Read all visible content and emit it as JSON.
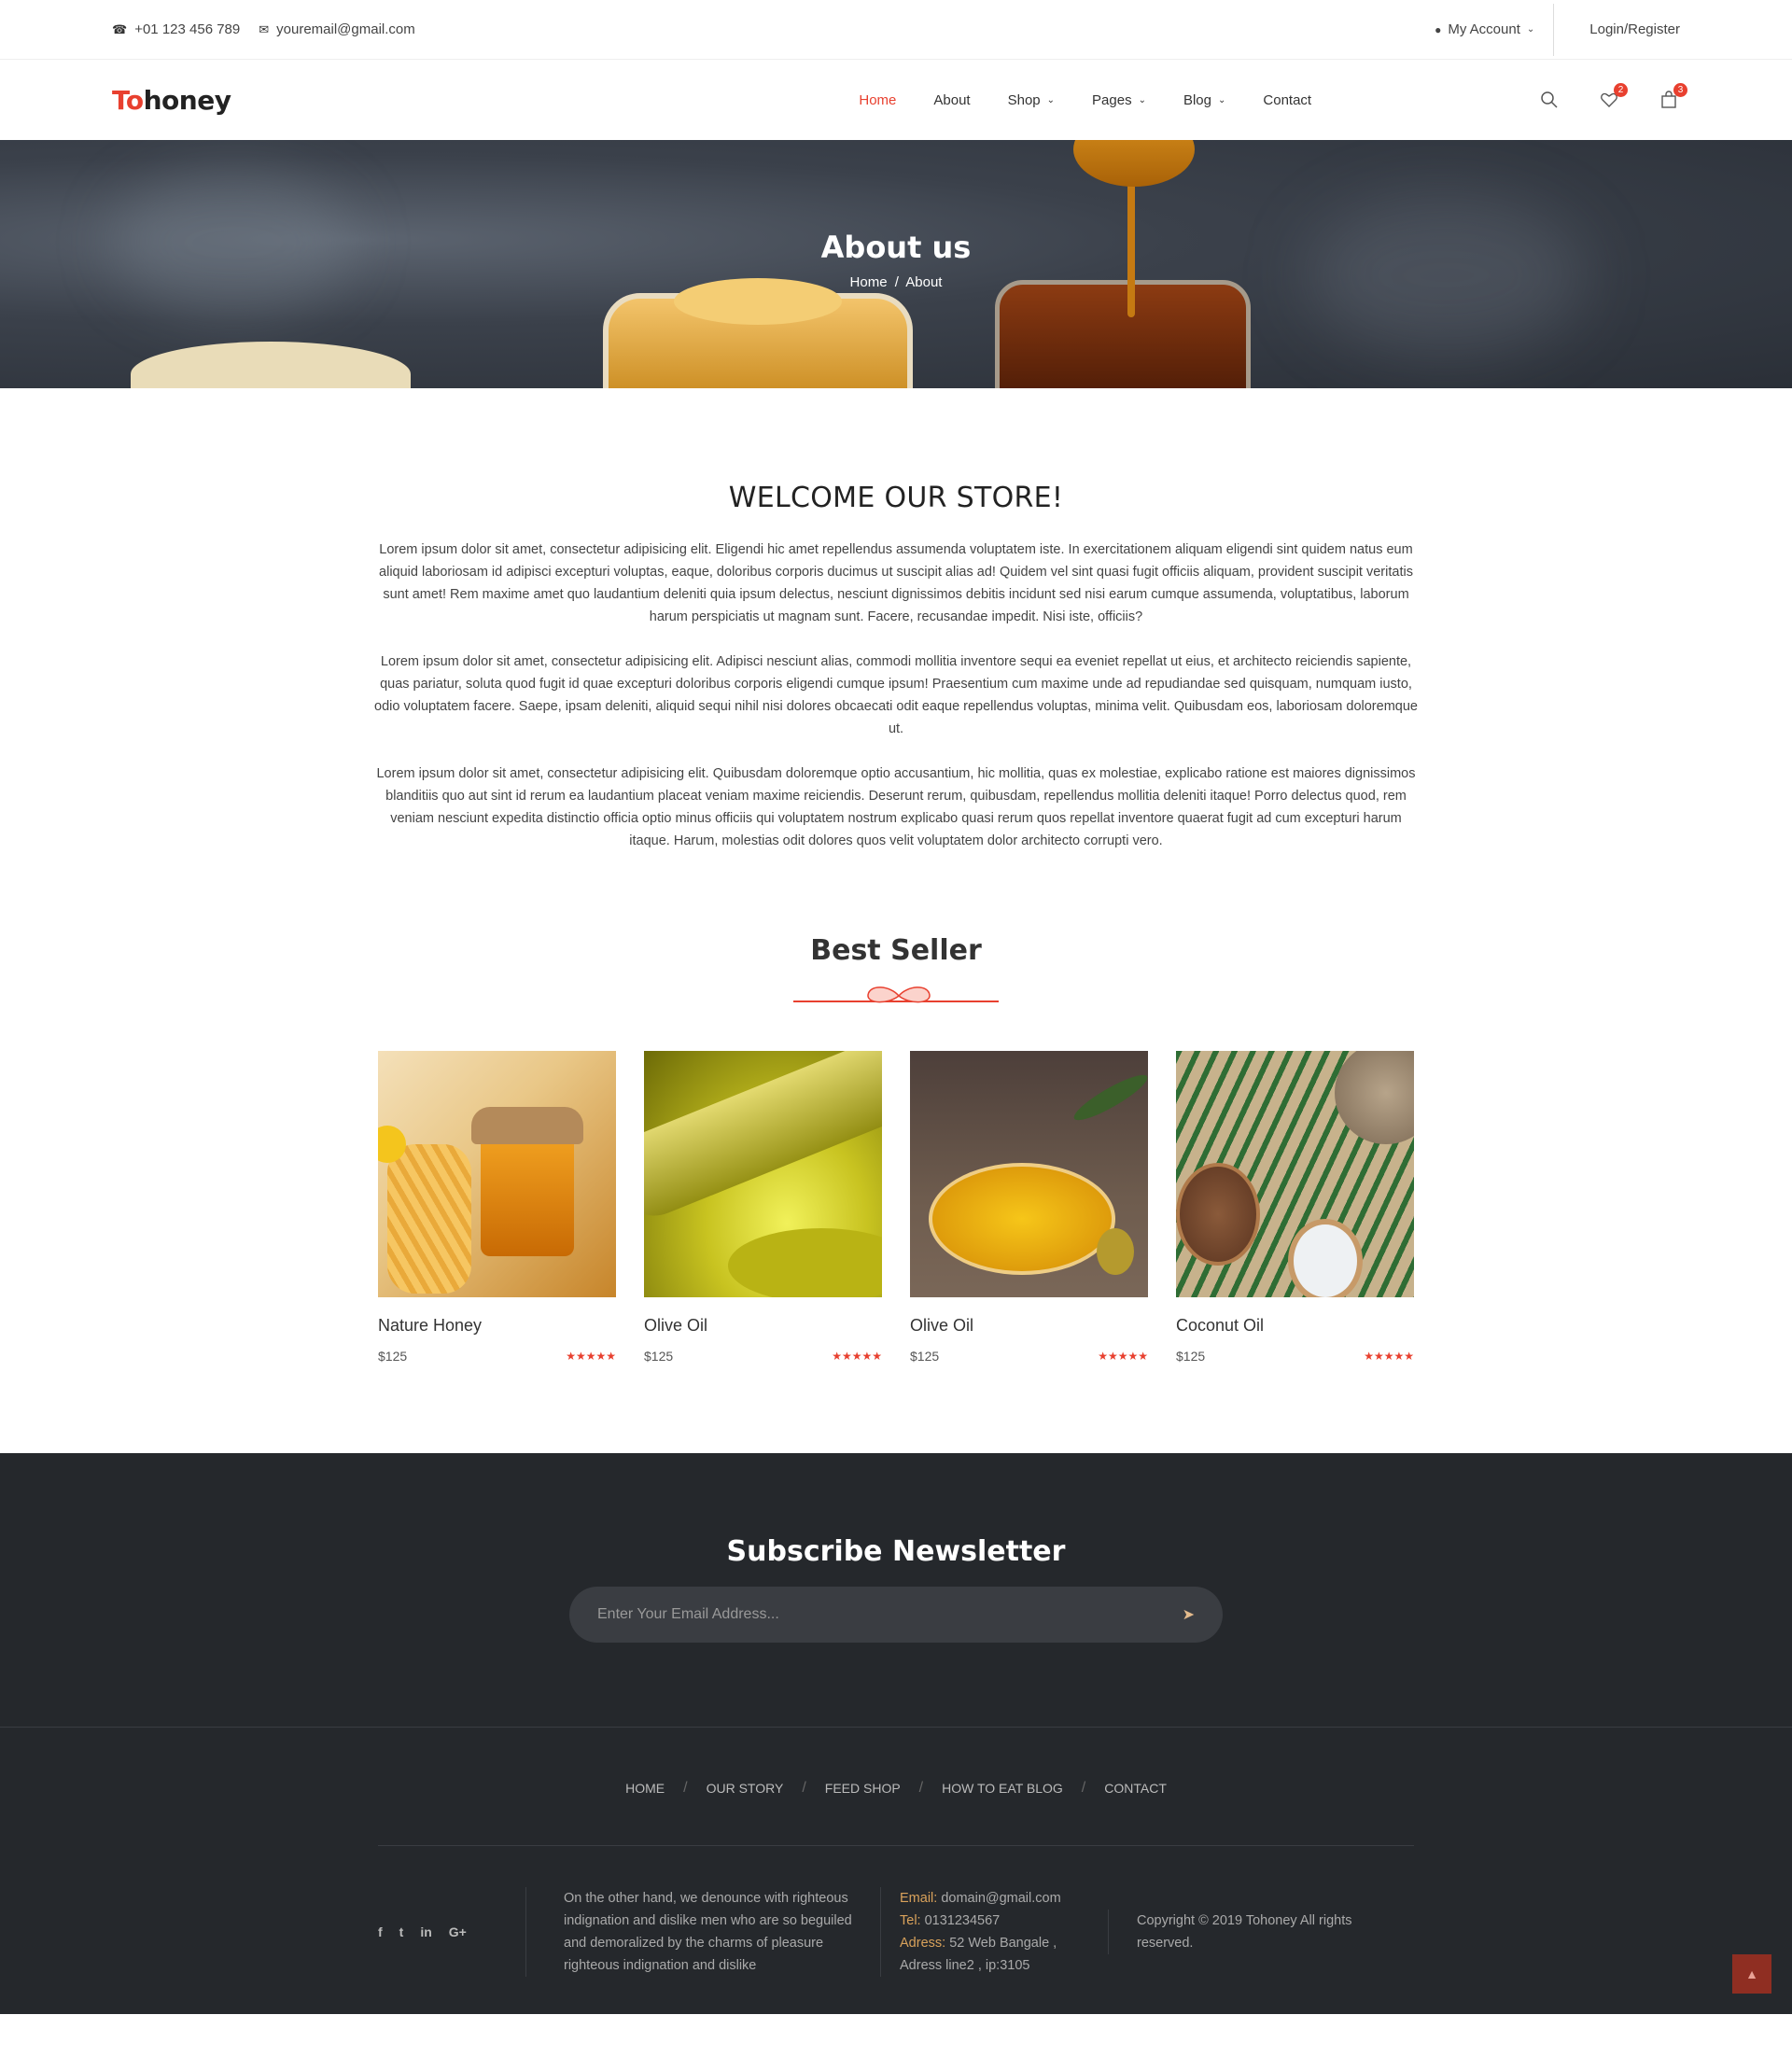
{
  "topbar": {
    "phone": "+01 123 456 789",
    "email": "youremail@gmail.com",
    "account": "My Account",
    "login": "Login/Register"
  },
  "header": {
    "logo_a": "To",
    "logo_b": "honey",
    "nav": [
      "Home",
      "About",
      "Shop",
      "Pages",
      "Blog",
      "Contact"
    ],
    "wishlist_count": "2",
    "cart_count": "3"
  },
  "hero": {
    "title": "About us",
    "crumb_home": "Home",
    "crumb_sep": "/",
    "crumb_current": "About"
  },
  "welcome": {
    "title": "WELCOME OUR STORE!",
    "paragraphs": [
      "Lorem ipsum dolor sit amet, consectetur adipisicing elit. Eligendi hic amet repellendus assumenda voluptatem iste. In exercitationem aliquam eligendi sint quidem natus eum aliquid laboriosam id adipisci excepturi voluptas, eaque, doloribus corporis ducimus ut suscipit alias ad! Quidem vel sint quasi fugit officiis aliquam, provident suscipit veritatis sunt amet! Rem maxime amet quo laudantium deleniti quia ipsum delectus, nesciunt dignissimos debitis incidunt sed nisi earum cumque assumenda, voluptatibus, laborum harum perspiciatis ut magnam sunt. Facere, recusandae impedit. Nisi iste, officiis?",
      "Lorem ipsum dolor sit amet, consectetur adipisicing elit. Adipisci nesciunt alias, commodi mollitia inventore sequi ea eveniet repellat ut eius, et architecto reiciendis sapiente, quas pariatur, soluta quod fugit id quae excepturi doloribus corporis eligendi cumque ipsum! Praesentium cum maxime unde ad repudiandae sed quisquam, numquam iusto, odio voluptatem facere. Saepe, ipsam deleniti, aliquid sequi nihil nisi dolores obcaecati odit eaque repellendus voluptas, minima velit. Quibusdam eos, laboriosam doloremque ut.",
      "Lorem ipsum dolor sit amet, consectetur adipisicing elit. Quibusdam doloremque optio accusantium, hic mollitia, quas ex molestiae, explicabo ratione est maiores dignissimos blanditiis quo aut sint id rerum ea laudantium placeat veniam maxime reiciendis. Deserunt rerum, quibusdam, repellendus mollitia deleniti itaque! Porro delectus quod, rem veniam nesciunt expedita distinctio officia optio minus officiis qui voluptatem nostrum explicabo quasi rerum quos repellat inventore quaerat fugit ad cum excepturi harum itaque. Harum, molestias odit dolores quos velit voluptatem dolor architecto corrupti vero."
    ]
  },
  "best_seller": {
    "title": "Best Seller",
    "products": [
      {
        "name": "Nature Honey",
        "price": "$125",
        "rating": "★★★★★"
      },
      {
        "name": "Olive Oil",
        "price": "$125",
        "rating": "★★★★★"
      },
      {
        "name": "Olive Oil",
        "price": "$125",
        "rating": "★★★★★"
      },
      {
        "name": "Coconut Oil",
        "price": "$125",
        "rating": "★★★★★"
      }
    ]
  },
  "newsletter": {
    "title": "Subscribe Newsletter",
    "placeholder": "Enter Your Email Address..."
  },
  "footer": {
    "nav": [
      "HOME",
      "OUR STORY",
      "FEED SHOP",
      "HOW TO EAT BLOG",
      "CONTACT"
    ],
    "social": [
      "f",
      "t",
      "in",
      "G+"
    ],
    "about": "On the other hand, we denounce with righteous indignation and dislike men who are so beguiled and demoralized by the charms of pleasure righteous indignation and dislike",
    "email_label": "Email:",
    "email": "domain@gmail.com",
    "tel_label": "Tel:",
    "tel": "0131234567",
    "address_label": "Adress:",
    "address": "52 Web Bangale , Adress line2 , ip:3105",
    "copyright": "Copyright © 2019 Tohoney All rights reserved."
  },
  "colors": {
    "accent": "#e8402f",
    "dark_bg": "#25282c",
    "label_gold": "#d9a25b"
  }
}
